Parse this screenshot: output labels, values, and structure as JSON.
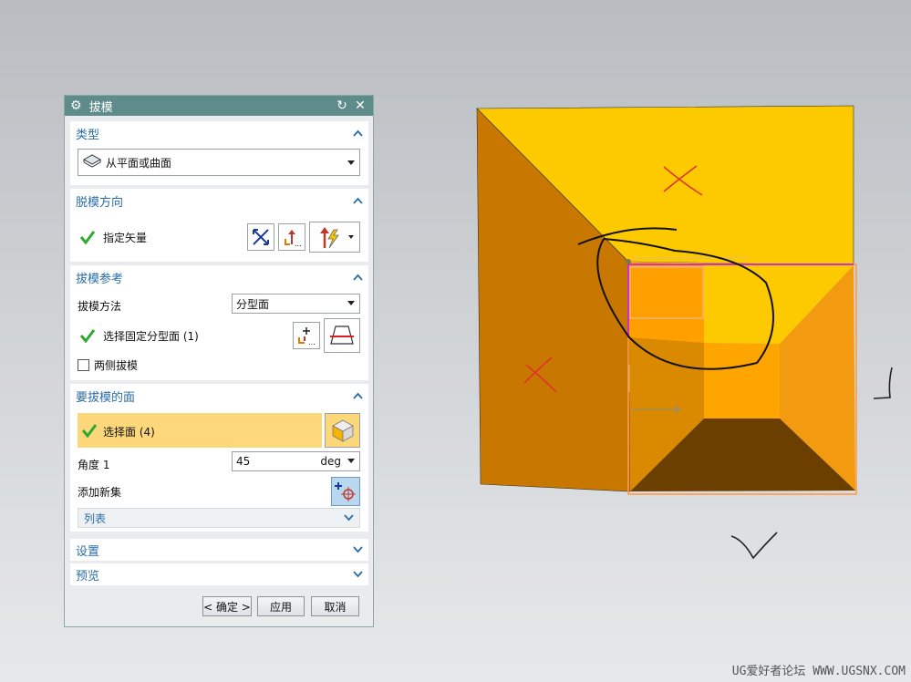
{
  "dialog": {
    "title": "拔模",
    "type_section": {
      "header": "类型",
      "selected_type": "从平面或曲面"
    },
    "direction_section": {
      "header": "脱模方向",
      "vector_label": "指定矢量"
    },
    "reference_section": {
      "header": "拔模参考",
      "method_label": "拔模方法",
      "method_value": "分型面",
      "parting_label": "选择固定分型面 (1)",
      "both_sides_label": "两侧拔模"
    },
    "faces_section": {
      "header": "要拔模的面",
      "select_label": "选择面 (4)",
      "angle_label": "角度 1",
      "angle_value": "45",
      "angle_unit": "deg",
      "add_set_label": "添加新集",
      "list_label": "列表"
    },
    "settings_section": {
      "header": "设置"
    },
    "preview_section": {
      "header": "预览"
    },
    "buttons": {
      "ok": "< 确定 >",
      "apply": "应用",
      "cancel": "取消"
    }
  },
  "watermark": "UG爱好者论坛 WWW.UGSNX.COM",
  "colors": {
    "title_bar": "#5e8c8a",
    "section_header": "#2a6ea8",
    "highlight_row": "#fcd87a",
    "model_top": "#fdca00",
    "model_side": "#c87800",
    "model_inner": "#f29a10",
    "model_floor": "#6b3f00"
  }
}
